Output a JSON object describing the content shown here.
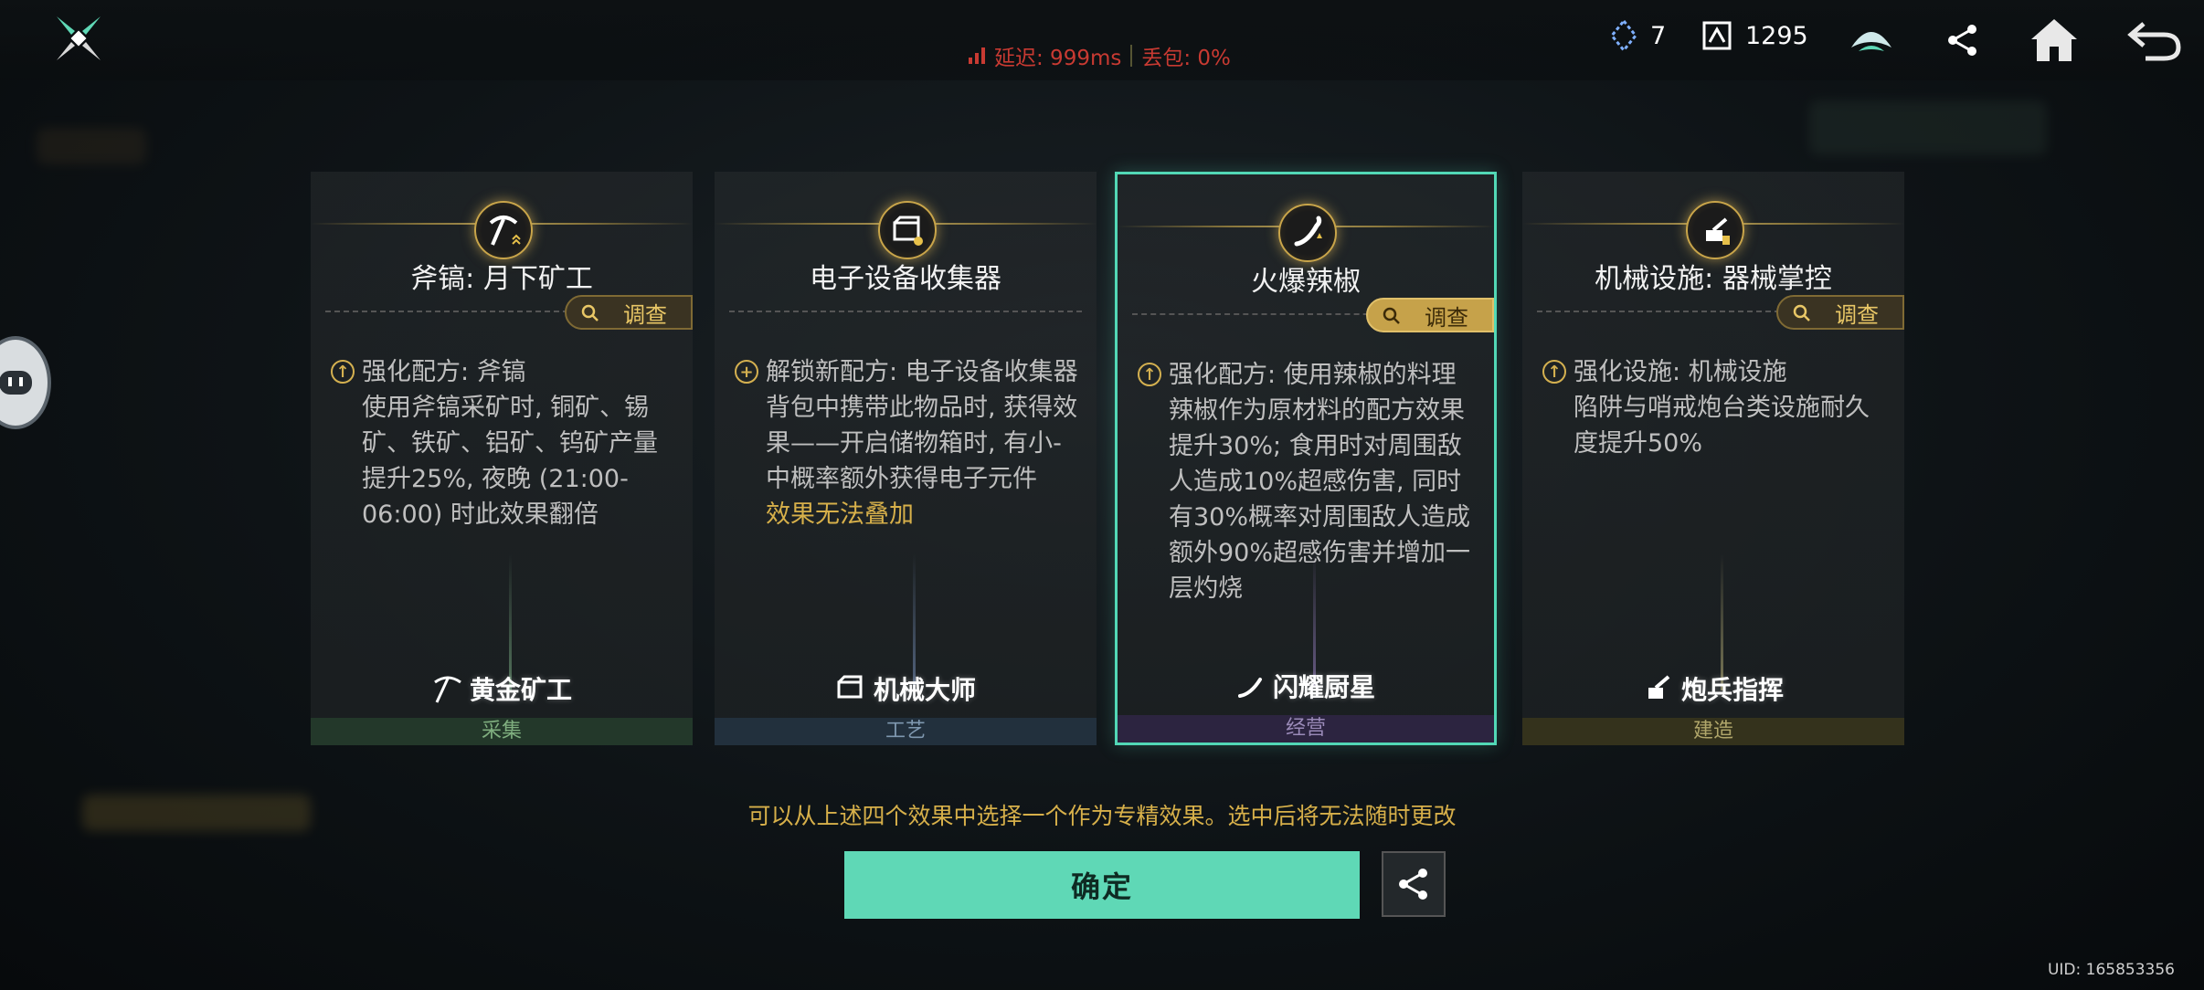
{
  "network": {
    "latency": "延迟: 999ms",
    "packet_loss": "丢包: 0%"
  },
  "resources": {
    "crystal_count": "7",
    "currency_count": "1295"
  },
  "cards": [
    {
      "title": "斧镐: 月下矿工",
      "inspect_label": "调查",
      "lines": [
        "强化配方: 斧镐",
        "使用斧镐采矿时, 铜矿、锡矿、铁矿、铝矿、钨矿产量提升25%, 夜晚 (21:00-06:00) 时此效果翻倍"
      ],
      "warning": "",
      "badge": "黄金矿工",
      "category": "采集",
      "bullet_icon": "upgrade-icon",
      "category_color": "#233a2a",
      "category_text_color": "#7fae7f"
    },
    {
      "title": "电子设备收集器",
      "inspect_label": "",
      "lines": [
        "解锁新配方: 电子设备收集器",
        "背包中携带此物品时, 获得效果——开启储物箱时, 有小-中概率额外获得电子元件"
      ],
      "warning": "效果无法叠加",
      "badge": "机械大师",
      "category": "工艺",
      "bullet_icon": "unlock-plus-icon",
      "category_color": "#22303d",
      "category_text_color": "#7f98b0"
    },
    {
      "title": "火爆辣椒",
      "inspect_label": "调查",
      "lines": [
        "强化配方: 使用辣椒的料理",
        "辣椒作为原材料的配方效果提升30%; 食用时对周围敌人造成10%超感伤害, 同时有30%概率对周围敌人造成额外90%超感伤害并增加一层灼烧"
      ],
      "warning": "",
      "badge": "闪耀厨星",
      "category": "经营",
      "bullet_icon": "upgrade-icon",
      "category_color": "#2c2440",
      "category_text_color": "#9a8ab8"
    },
    {
      "title": "机械设施: 器械掌控",
      "inspect_label": "调查",
      "lines": [
        "强化设施: 机械设施",
        "陷阱与哨戒炮台类设施耐久度提升50%"
      ],
      "warning": "",
      "badge": "炮兵指挥",
      "category": "建造",
      "bullet_icon": "upgrade-icon",
      "category_color": "#34321c",
      "category_text_color": "#b0a66a"
    }
  ],
  "hint": "可以从上述四个效果中选择一个作为专精效果。选中后将无法随时更改",
  "confirm_label": "确定",
  "uid": "UID: 165853356",
  "colors": {
    "accent": "#5fd8b6",
    "gold": "#d7b04a",
    "danger": "#c83a32"
  }
}
